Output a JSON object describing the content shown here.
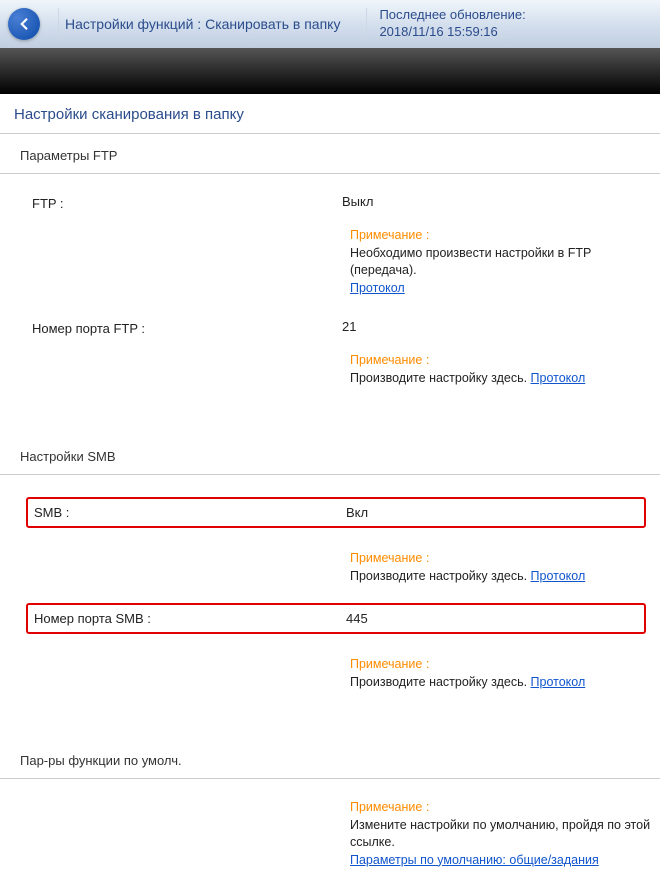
{
  "header": {
    "title": "Настройки функций : Сканировать в папку",
    "update_label": "Последнее обновление:",
    "update_time": "2018/11/16 15:59:16"
  },
  "page_title": "Настройки сканирования в папку",
  "ftp": {
    "section_title": "Параметры FTP",
    "label": "FTP :",
    "value": "Выкл",
    "note_label": "Примечание :",
    "note_text": "Необходимо произвести настройки в FTP (передача).",
    "link": "Протокол",
    "port_label": "Номер порта FTP :",
    "port_value": "21",
    "port_note_label": "Примечание :",
    "port_note_text": "Производите настройку здесь. ",
    "port_link": "Протокол"
  },
  "smb": {
    "section_title": "Настройки SMB",
    "label": "SMB :",
    "value": "Вкл",
    "note_label": "Примечание :",
    "note_text": "Производите настройку здесь. ",
    "link": "Протокол",
    "port_label": "Номер порта SMB :",
    "port_value": "445",
    "port_note_label": "Примечание :",
    "port_note_text": "Производите настройку здесь. ",
    "port_link": "Протокол"
  },
  "defaults": {
    "section_title": "Пар-ры функции по умолч.",
    "note_label": "Примечание :",
    "note_text": "Измените настройки по умолчанию, пройдя по этой ссылке. ",
    "link": "Параметры по умолчанию: общие/задания"
  }
}
